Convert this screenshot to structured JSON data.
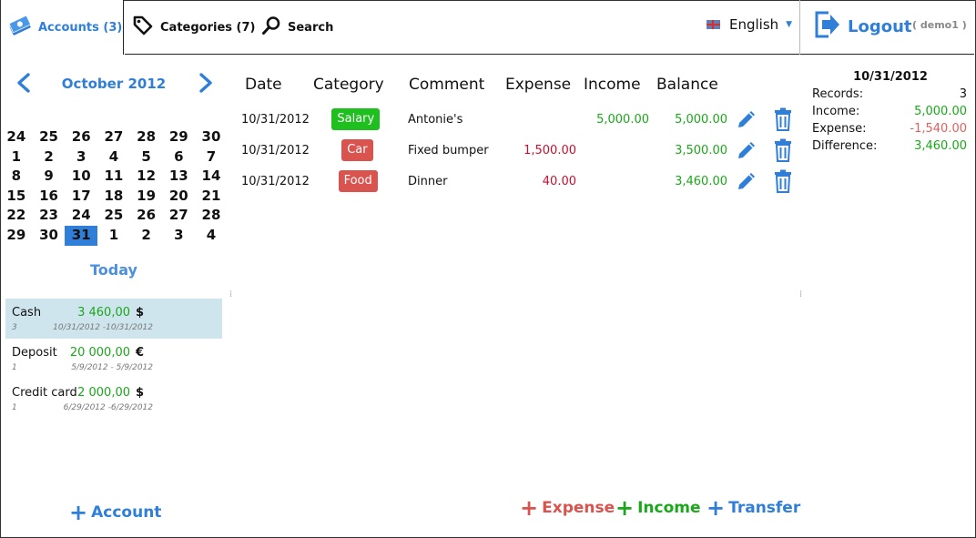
{
  "tabs": {
    "accounts": "Accounts (3)",
    "categories": "Categories (7)",
    "search": "Search"
  },
  "header": {
    "language": "English",
    "logout": "Logout",
    "user": "( demo1 )"
  },
  "calendar": {
    "month": "October 2012",
    "weeks": [
      [
        "24",
        "25",
        "26",
        "27",
        "28",
        "29",
        "30"
      ],
      [
        "1",
        "2",
        "3",
        "4",
        "5",
        "6",
        "7"
      ],
      [
        "8",
        "9",
        "10",
        "11",
        "12",
        "13",
        "14"
      ],
      [
        "15",
        "16",
        "17",
        "18",
        "19",
        "20",
        "21"
      ],
      [
        "22",
        "23",
        "24",
        "25",
        "26",
        "27",
        "28"
      ],
      [
        "29",
        "30",
        "31",
        "1",
        "2",
        "3",
        "4"
      ]
    ],
    "selected_day": "31",
    "today": "Today"
  },
  "accounts": [
    {
      "name": "Cash",
      "amount": "3 460,00",
      "currency": "$",
      "count": "3",
      "range": "10/31/2012 -10/31/2012",
      "selected": true
    },
    {
      "name": "Deposit",
      "amount": "20 000,00",
      "currency": "€",
      "count": "1",
      "range": "5/9/2012 - 5/9/2012",
      "selected": false
    },
    {
      "name": "Credit card",
      "amount": "2 000,00",
      "currency": "$",
      "count": "1",
      "range": "6/29/2012 -6/29/2012",
      "selected": false
    }
  ],
  "add_account": "Account",
  "table": {
    "headers": {
      "date": "Date",
      "category": "Category",
      "comment": "Comment",
      "expense": "Expense",
      "income": "Income",
      "balance": "Balance"
    },
    "rows": [
      {
        "date": "10/31/2012",
        "category": "Salary",
        "category_color": "#1fbf1f",
        "comment": "Antonie's",
        "expense": "",
        "income": "5,000.00",
        "balance": "5,000.00"
      },
      {
        "date": "10/31/2012",
        "category": "Car",
        "category_color": "#d9534f",
        "comment": "Fixed bumper",
        "expense": "1,500.00",
        "income": "",
        "balance": "3,500.00"
      },
      {
        "date": "10/31/2012",
        "category": "Food",
        "category_color": "#d9534f",
        "comment": "Dinner",
        "expense": "40.00",
        "income": "",
        "balance": "3,460.00"
      }
    ]
  },
  "actions": {
    "expense": "Expense",
    "income": "Income",
    "transfer": "Transfer"
  },
  "summary": {
    "date": "10/31/2012",
    "records_label": "Records:",
    "records": "3",
    "income_label": "Income:",
    "income": "5,000.00",
    "expense_label": "Expense:",
    "expense": "-1,540.00",
    "difference_label": "Difference:",
    "difference": "3,460.00"
  },
  "colors": {
    "accent": "#2f7fd8",
    "income_green": "#1aa81a",
    "expense_red": "#c8102e",
    "selected_row": "#cfe5ee"
  }
}
